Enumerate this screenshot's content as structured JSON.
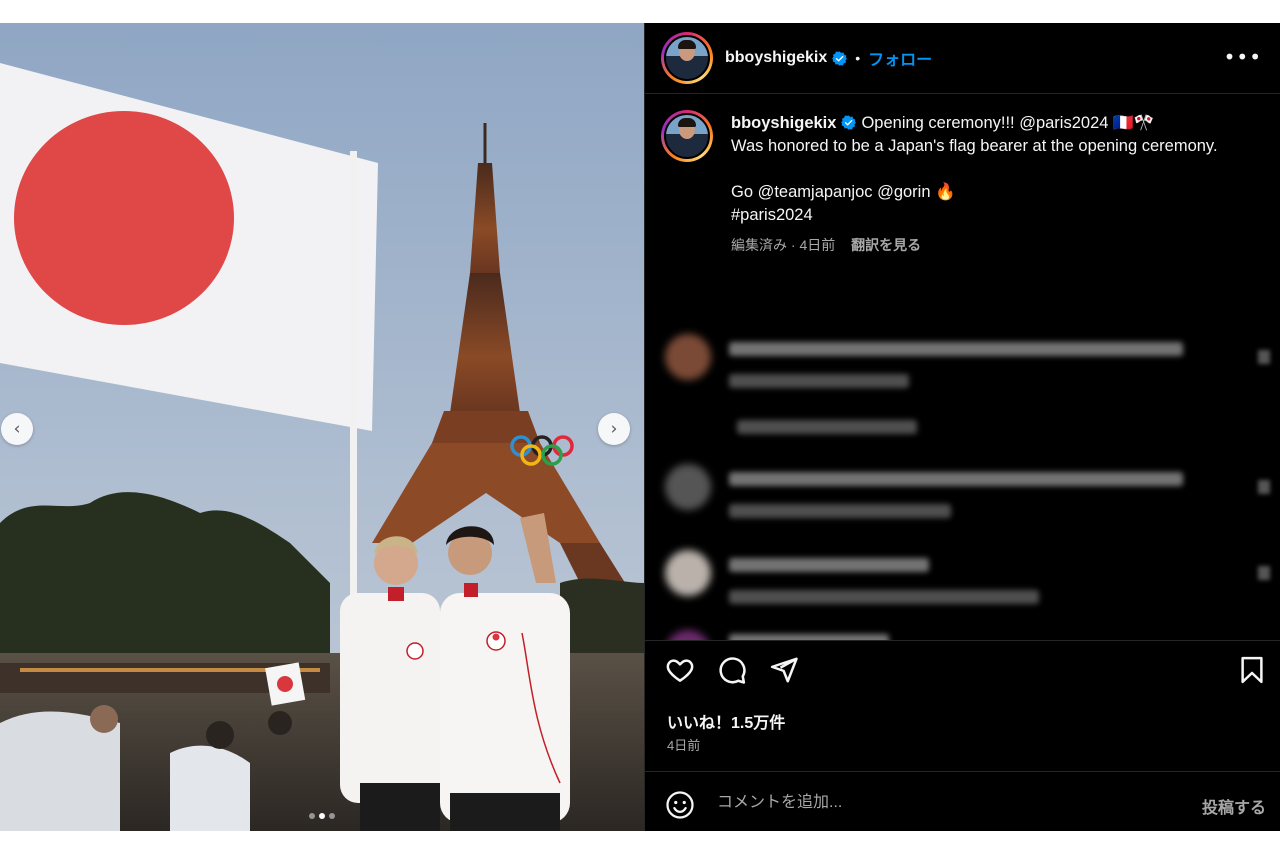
{
  "header": {
    "username": "bboyshigekix",
    "separator": "•",
    "follow_label": "フォロー",
    "more_label": "•••"
  },
  "caption": {
    "username": "bboyshigekix",
    "text": "Opening ceremony!!! @paris2024 🇫🇷🎌\nWas honored to be a Japan's flag bearer at the opening ceremony.\n\nGo @teamjapanjoc @gorin 🔥\n#paris2024",
    "edited": "編集済み · 4日前",
    "translate_label": "翻訳を見る"
  },
  "media": {
    "prev_label": "‹",
    "next_label": "›",
    "slide_count": 3,
    "active_slide": 2
  },
  "icons": {
    "like": "heart-icon",
    "comment": "comment-icon",
    "share": "send-icon",
    "save": "bookmark-icon",
    "emoji": "smile-icon",
    "verified": "verified-badge-icon"
  },
  "stats": {
    "likes": "いいね！1.5万件",
    "date": "4日前"
  },
  "composer": {
    "placeholder": "コメントを追加...",
    "post_label": "投稿する"
  },
  "colors": {
    "accent": "#0095f6",
    "panel_bg": "#000000",
    "text": "#f5f5f5",
    "muted": "#a8a8a8"
  }
}
